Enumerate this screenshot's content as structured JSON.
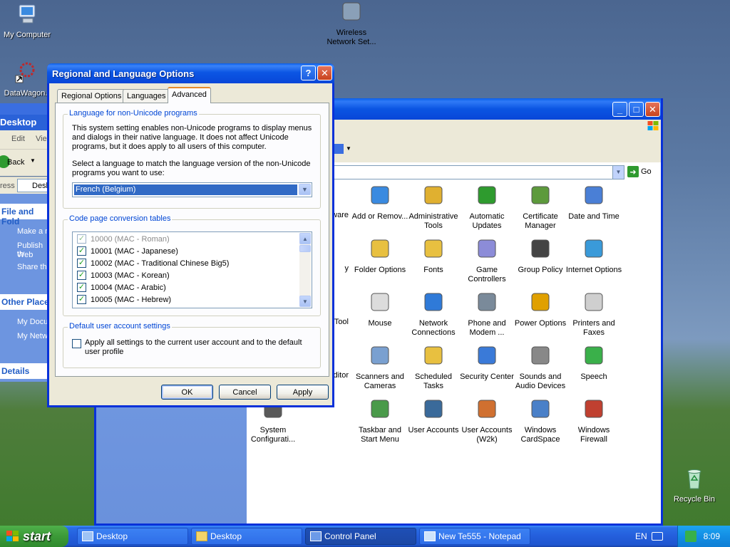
{
  "desktop": {
    "icons": [
      {
        "label": "My Computer",
        "icon": "my-computer-icon"
      },
      {
        "label": "DataWagon.",
        "icon": "datawagon-shortcut-icon"
      },
      {
        "label": "Recycle Bin",
        "icon": "recycle-bin-icon"
      }
    ]
  },
  "explorer_back": {
    "title": "Desktop",
    "toolbar_edit": "Edit",
    "toolbar_view": "Vie",
    "back_label": "Back",
    "address_label": "ress",
    "address_value": "Desk",
    "sections": [
      {
        "heading": "File and Fold",
        "links": [
          "Make a n",
          "Publish th",
          "Web",
          "Share thi"
        ]
      },
      {
        "heading": "Other Place",
        "links": [
          "My Docu",
          "My Netw"
        ]
      },
      {
        "heading": "Details",
        "links": []
      }
    ]
  },
  "control_panel": {
    "go_label": "Go",
    "items": [
      {
        "label": "ware",
        "icon": "hardware-icon"
      },
      {
        "label": "Add or Remov...",
        "icon": "add-remove-programs-icon"
      },
      {
        "label": "Administrative Tools",
        "icon": "administrative-tools-icon"
      },
      {
        "label": "Automatic Updates",
        "icon": "automatic-updates-icon"
      },
      {
        "label": "Certificate Manager",
        "icon": "certificate-manager-icon"
      },
      {
        "label": "Date and Time",
        "icon": "date-time-icon"
      },
      {
        "label": "y",
        "icon": "accessibility-icon"
      },
      {
        "label": "Folder Options",
        "icon": "folder-options-icon"
      },
      {
        "label": "Fonts",
        "icon": "fonts-icon"
      },
      {
        "label": "Game Controllers",
        "icon": "game-controllers-icon"
      },
      {
        "label": "Group Policy",
        "icon": "group-policy-icon"
      },
      {
        "label": "Internet Options",
        "icon": "internet-options-icon"
      },
      {
        "label": "us Tool",
        "icon": "tool-icon"
      },
      {
        "label": "Mouse",
        "icon": "mouse-icon"
      },
      {
        "label": "Network Connections",
        "icon": "network-connections-icon"
      },
      {
        "label": "Phone and Modem ...",
        "icon": "phone-modem-icon"
      },
      {
        "label": "Power Options",
        "icon": "power-options-icon"
      },
      {
        "label": "Printers and Faxes",
        "icon": "printers-faxes-icon"
      },
      {
        "label": "Editor",
        "icon": "editor-icon"
      },
      {
        "label": "Scanners and Cameras",
        "icon": "scanners-cameras-icon"
      },
      {
        "label": "Scheduled Tasks",
        "icon": "scheduled-tasks-icon"
      },
      {
        "label": "Security Center",
        "icon": "security-center-icon"
      },
      {
        "label": "Sounds and Audio Devices",
        "icon": "sounds-audio-icon"
      },
      {
        "label": "Speech",
        "icon": "speech-icon"
      },
      {
        "label": "System Configurati...",
        "icon": "system-configuration-icon"
      },
      {
        "label": "Taskbar and Start Menu",
        "icon": "taskbar-start-menu-icon"
      },
      {
        "label": "User Accounts",
        "icon": "user-accounts-icon"
      },
      {
        "label": "User Accounts (W2k)",
        "icon": "user-accounts-w2k-icon"
      },
      {
        "label": "Windows CardSpace",
        "icon": "windows-cardspace-icon"
      },
      {
        "label": "Windows Firewall",
        "icon": "windows-firewall-icon"
      },
      {
        "label": "Wireless Network Set...",
        "icon": "wireless-network-icon"
      }
    ]
  },
  "dialog": {
    "title": "Regional and Language Options",
    "help_glyph": "?",
    "close_glyph": "✕",
    "tabs": [
      "Regional Options",
      "Languages",
      "Advanced"
    ],
    "active_tab": "Advanced",
    "group1": {
      "label": "Language for non-Unicode programs",
      "description": "This system setting enables non-Unicode programs to display menus and dialogs in their native language. It does not affect Unicode programs, but it does apply to all users of this computer.",
      "prompt": "Select a language to match the language version of the non-Unicode programs you want to use:",
      "selected_language": "French (Belgium)"
    },
    "group2": {
      "label": "Code page conversion tables",
      "items": [
        "10000 (MAC - Roman)",
        "10001 (MAC - Japanese)",
        "10002 (MAC - Traditional Chinese Big5)",
        "10003 (MAC - Korean)",
        "10004 (MAC - Arabic)",
        "10005 (MAC - Hebrew)"
      ]
    },
    "group3": {
      "label": "Default user account settings",
      "checkbox_label": "Apply all settings to the current user account and to the default user profile"
    },
    "buttons": {
      "ok": "OK",
      "cancel": "Cancel",
      "apply": "Apply"
    }
  },
  "taskbar": {
    "start_label": "start",
    "tasks": [
      {
        "label": "Desktop",
        "icon": "explorer-window-icon"
      },
      {
        "label": "Desktop",
        "icon": "folder-icon"
      },
      {
        "label": "Control Panel",
        "icon": "control-panel-icon"
      },
      {
        "label": "New Te555 - Notepad",
        "icon": "notepad-icon"
      }
    ],
    "language": "EN",
    "clock": "8:09"
  }
}
